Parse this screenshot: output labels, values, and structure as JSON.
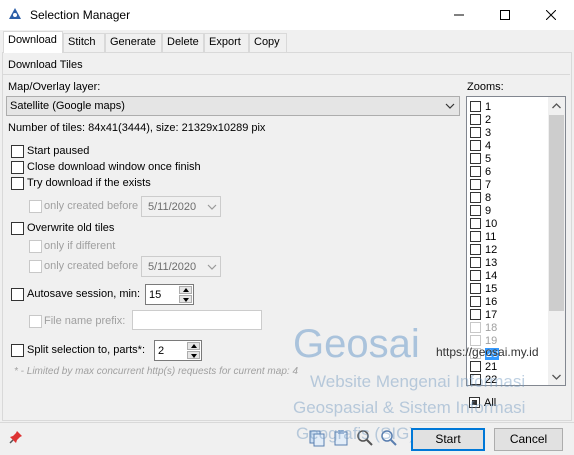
{
  "window": {
    "title": "Selection Manager",
    "min_icon": "minimize-icon",
    "max_icon": "maximize-icon",
    "close_icon": "close-icon"
  },
  "tabs": [
    {
      "label": "Download",
      "active": true
    },
    {
      "label": "Stitch"
    },
    {
      "label": "Generate"
    },
    {
      "label": "Delete"
    },
    {
      "label": "Export"
    },
    {
      "label": "Copy"
    }
  ],
  "panel": {
    "section_title": "Download Tiles",
    "layer_label": "Map/Overlay layer:",
    "layer_value": "Satellite (Google maps)",
    "tiles_info": "Number of tiles: 84x41(3444), size: 21329x10289 pix",
    "start_paused": "Start paused",
    "close_window": "Close download window once finish",
    "try_download": "Try download if the exists",
    "only_created_before": "only created before",
    "date1": "5/11/2020",
    "overwrite": "Overwrite old tiles",
    "only_if_different": "only if different",
    "only_created_before2": "only created before",
    "date2": "5/11/2020",
    "autosave": "Autosave session, min:",
    "autosave_value": "15",
    "file_prefix": "File name prefix:",
    "split": "Split selection to, parts*:",
    "split_value": "2",
    "note": "* - Limited by max concurrent http(s) requests for current map: 4"
  },
  "zooms": {
    "label": "Zooms:",
    "items": [
      "1",
      "2",
      "3",
      "4",
      "5",
      "6",
      "7",
      "8",
      "9",
      "10",
      "11",
      "12",
      "13",
      "14",
      "15",
      "16",
      "17",
      "18",
      "19",
      "20",
      "21",
      "22"
    ],
    "selected": "20",
    "all_label": "All"
  },
  "footer": {
    "pin_icon": "pin-icon",
    "start": "Start",
    "cancel": "Cancel"
  },
  "watermark": {
    "brand": "Geosai",
    "url": "https://geosai.my.id",
    "line1": "Website Mengenai Informasi",
    "line2": "Geospasial & Sistem Informasi",
    "line3": "Geografis (SIG)"
  }
}
